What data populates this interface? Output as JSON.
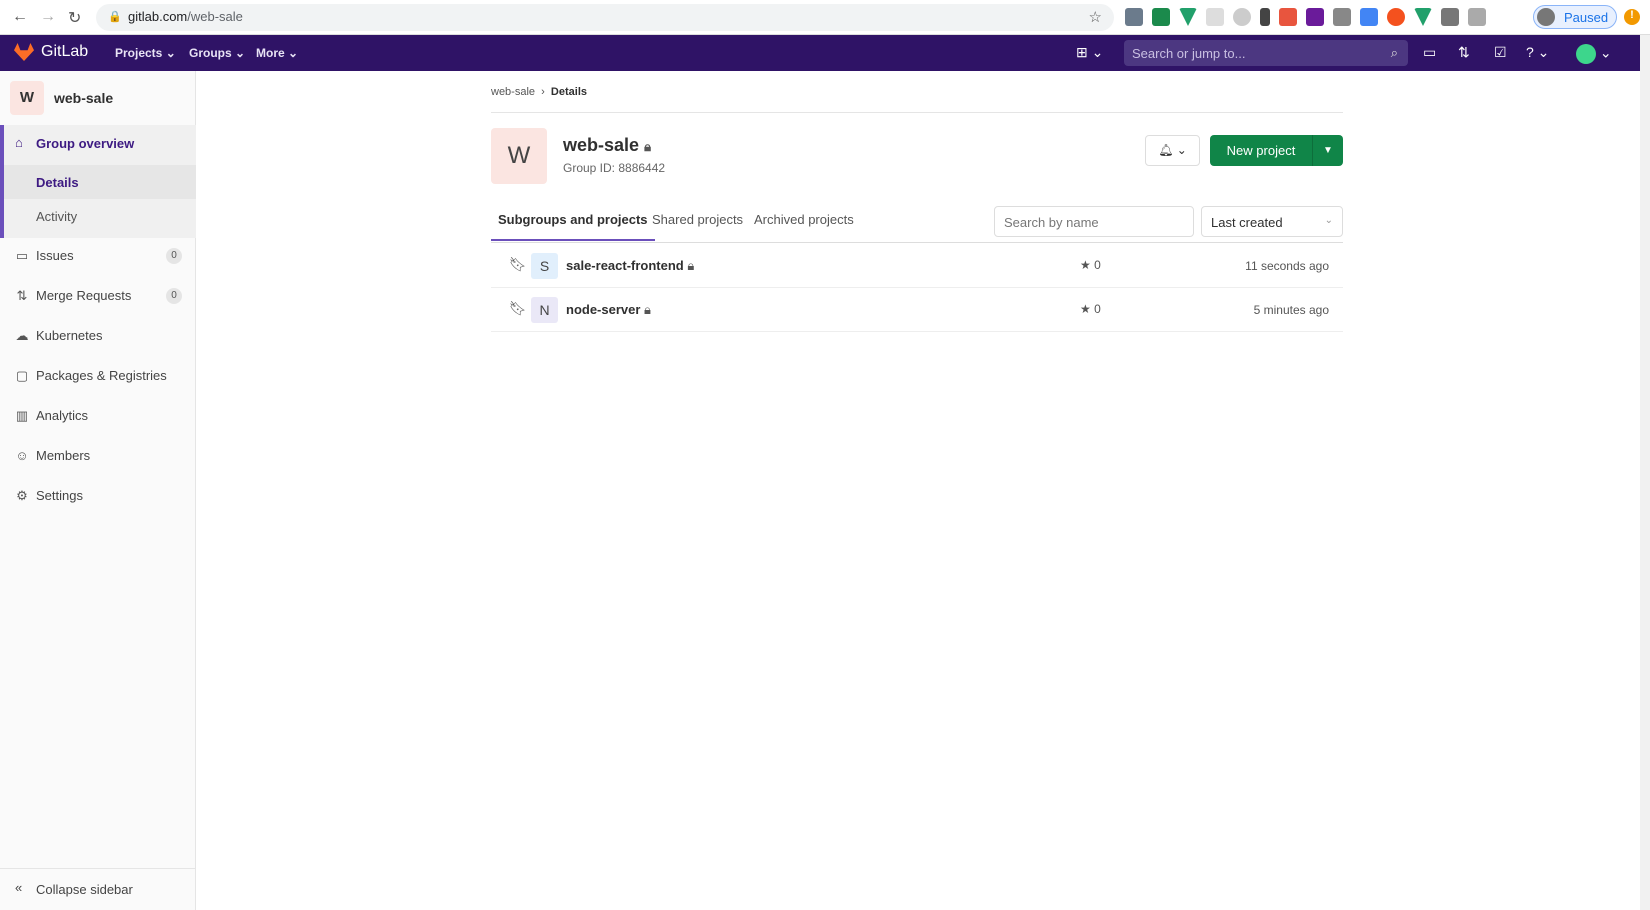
{
  "browser": {
    "url_host": "gitlab.com",
    "url_path": "/web-sale",
    "profile_label": "Paused"
  },
  "topbar": {
    "brand": "GitLab",
    "menus": [
      "Projects",
      "Groups",
      "More"
    ],
    "search_placeholder": "Search or jump to..."
  },
  "sidebar": {
    "group_initial": "W",
    "group_name": "web-sale",
    "overview": "Group overview",
    "sub_items": [
      "Details",
      "Activity"
    ],
    "items": [
      {
        "label": "Issues",
        "icon": "issues-icon",
        "count": "0"
      },
      {
        "label": "Merge Requests",
        "icon": "merge-request-icon",
        "count": "0"
      },
      {
        "label": "Kubernetes",
        "icon": "kubernetes-icon"
      },
      {
        "label": "Packages & Registries",
        "icon": "package-icon"
      },
      {
        "label": "Analytics",
        "icon": "analytics-icon"
      },
      {
        "label": "Members",
        "icon": "members-icon"
      },
      {
        "label": "Settings",
        "icon": "settings-icon"
      }
    ],
    "collapse": "Collapse sidebar"
  },
  "main": {
    "breadcrumb": [
      "web-sale",
      "Details"
    ],
    "avatar_initial": "W",
    "title": "web-sale",
    "group_id": "Group ID: 8886442",
    "new_project": "New project",
    "tabs": [
      "Subgroups and projects",
      "Shared projects",
      "Archived projects"
    ],
    "search_placeholder": "Search by name",
    "sort": "Last created",
    "projects": [
      {
        "initial": "S",
        "name": "sale-react-frontend",
        "stars": "0",
        "updated": "11 seconds ago",
        "color": "#e1effc"
      },
      {
        "initial": "N",
        "name": "node-server",
        "stars": "0",
        "updated": "5 minutes ago",
        "color": "#eae8f7"
      }
    ]
  }
}
